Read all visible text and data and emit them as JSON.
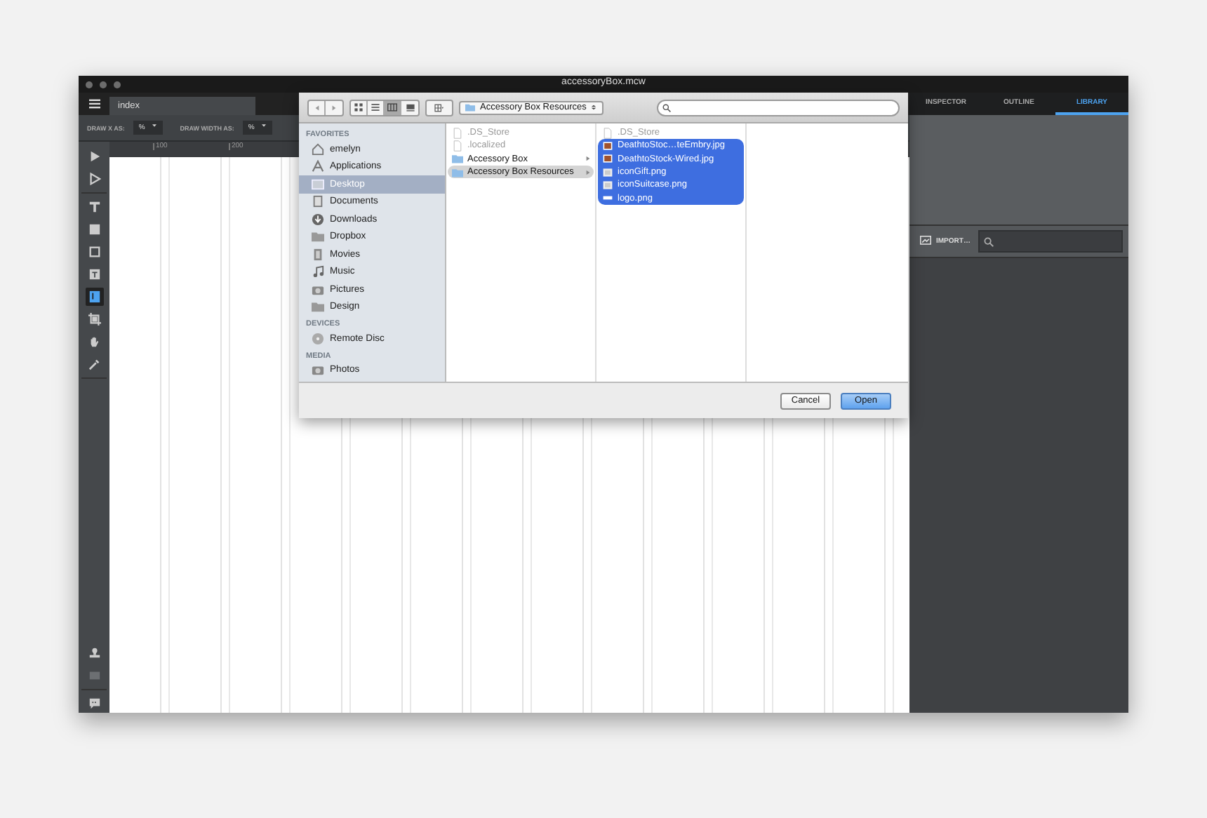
{
  "window": {
    "title": "accessoryBox.mcw"
  },
  "tabs": [
    {
      "label": "index",
      "selected": true
    }
  ],
  "toolbar": {
    "fields": [
      {
        "label": "DRAW X AS:",
        "value": "%"
      },
      {
        "label": "DRAW WIDTH AS:",
        "value": "%"
      }
    ]
  },
  "ruler": {
    "ticks": [
      "100",
      "200"
    ]
  },
  "tools": [
    {
      "kind": "pointer",
      "selected": false
    },
    {
      "kind": "hollow-pointer",
      "selected": false
    },
    {
      "kind": "text",
      "selected": false
    },
    {
      "kind": "square",
      "selected": false
    },
    {
      "kind": "frame",
      "selected": false
    },
    {
      "kind": "textbox",
      "selected": false
    },
    {
      "kind": "image",
      "selected": true
    },
    {
      "kind": "crop",
      "selected": false
    },
    {
      "kind": "hand",
      "selected": false
    },
    {
      "kind": "eyedropper",
      "selected": false
    }
  ],
  "bottom_tools": [
    {
      "kind": "stamp",
      "disabled": false
    },
    {
      "kind": "photo",
      "disabled": true
    },
    {
      "kind": "comment",
      "disabled": false
    }
  ],
  "dialog": {
    "view_buttons": [
      {
        "kind": "icons",
        "selected": false
      },
      {
        "kind": "list",
        "selected": false
      },
      {
        "kind": "columns",
        "selected": true
      },
      {
        "kind": "coverflow",
        "selected": false
      }
    ],
    "path": "Accessory Box Resources",
    "sidebar": [
      {
        "heading": "FAVORITES",
        "items": [
          {
            "label": "emelyn",
            "kind": "home",
            "selected": false
          },
          {
            "label": "Applications",
            "kind": "apps",
            "selected": false
          },
          {
            "label": "Desktop",
            "kind": "desktop",
            "selected": true
          },
          {
            "label": "Documents",
            "kind": "doc",
            "selected": false
          },
          {
            "label": "Downloads",
            "kind": "download",
            "selected": false
          },
          {
            "label": "Dropbox",
            "kind": "folder",
            "selected": false
          },
          {
            "label": "Movies",
            "kind": "movie",
            "selected": false
          },
          {
            "label": "Music",
            "kind": "music",
            "selected": false
          },
          {
            "label": "Pictures",
            "kind": "camera",
            "selected": false
          },
          {
            "label": "Design",
            "kind": "folder",
            "selected": false
          }
        ]
      },
      {
        "heading": "DEVICES",
        "items": [
          {
            "label": "Remote Disc",
            "kind": "disc",
            "selected": false
          }
        ]
      },
      {
        "heading": "MEDIA",
        "items": [
          {
            "label": "Photos",
            "kind": "camera",
            "selected": false
          }
        ]
      }
    ],
    "columns": [
      [
        {
          "name": ".DS_Store",
          "kind": "file",
          "disabled": true,
          "selected": false
        },
        {
          "name": ".localized",
          "kind": "file",
          "disabled": true,
          "selected": false
        },
        {
          "name": "Accessory Box",
          "kind": "folder",
          "disabled": false,
          "selected": false
        },
        {
          "name": "Accessory Box Resources",
          "kind": "folder",
          "disabled": false,
          "selected": true
        }
      ],
      [
        {
          "name": ".DS_Store",
          "kind": "file",
          "disabled": true,
          "selected": false
        },
        {
          "name": "DeathtoStoc…teEmbry.jpg",
          "kind": "photo",
          "disabled": false,
          "selected": true
        },
        {
          "name": "DeathtoStock-Wired.jpg",
          "kind": "photo",
          "disabled": false,
          "selected": true
        },
        {
          "name": "iconGift.png",
          "kind": "image",
          "disabled": false,
          "selected": true
        },
        {
          "name": "iconSuitcase.png",
          "kind": "image",
          "disabled": false,
          "selected": true
        },
        {
          "name": "logo.png",
          "kind": "logo",
          "disabled": false,
          "selected": true
        }
      ],
      []
    ],
    "buttons": [
      {
        "label": "Cancel",
        "default": false
      },
      {
        "label": "Open",
        "default": true
      }
    ]
  },
  "panel": {
    "tabs": [
      {
        "label": "INSPECTOR",
        "selected": false
      },
      {
        "label": "OUTLINE",
        "selected": false
      },
      {
        "label": "LIBRARY",
        "selected": true
      }
    ],
    "import": "IMPORT…"
  }
}
